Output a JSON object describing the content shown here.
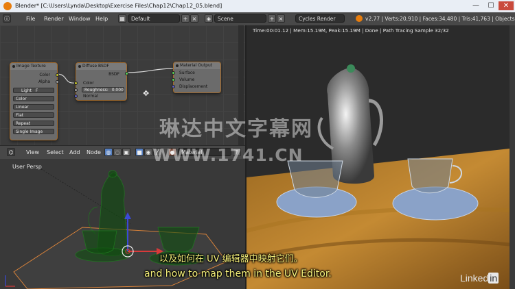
{
  "window": {
    "title": "Blender* [C:\\Users\\Lynda\\Desktop\\Exercise Files\\Chap12\\Chap12_05.blend]",
    "minimize_glyph": "—",
    "maximize_glyph": "☐",
    "close_glyph": "✕"
  },
  "info_header": {
    "menus": [
      "File",
      "Render",
      "Window",
      "Help"
    ],
    "screen_layout": "Default",
    "scene": "Scene",
    "render_engine": "Cycles Render",
    "stats": "v2.77 | Verts:20,910 | Faces:34,480 | Tris:41,763 | Objects:1/14"
  },
  "nodes": {
    "image_texture": {
      "title": "Image Texture",
      "out_color": "Color",
      "out_alpha": "Alpha",
      "image_name": "Light",
      "image_user": "F",
      "color_space": "Color",
      "interpolation": "Linear",
      "projection": "Flat",
      "extension": "Repeat",
      "single_image": "Single Image"
    },
    "diffuse": {
      "title": "Diffuse BSDF",
      "out_bsdf": "BSDF",
      "in_color": "Color",
      "roughness": "Roughness:",
      "roughness_value": "0.000",
      "in_normal": "Normal"
    },
    "output": {
      "title": "Material Output",
      "surface": "Surface",
      "volume": "Volume",
      "displacement": "Displacement"
    },
    "colors": {
      "color_socket": "#c7c729",
      "shader_socket": "#5bd15b",
      "vector_socket": "#6363c7",
      "gray_socket": "#a1a1a1"
    }
  },
  "node_header": {
    "menus": [
      "View",
      "Select",
      "Add",
      "Node"
    ],
    "material_label": "Material",
    "f_button": "F"
  },
  "viewport": {
    "label": "User Persp"
  },
  "render": {
    "status": "Time:00:01.12 | Mem:15.19M, Peak:15.19M | Done | Path Tracing Sample 32/32"
  },
  "overlay": {
    "watermark_line1": "琳达中文字幕网",
    "watermark_line2": "WWW.1741.CN",
    "subtitle_cn": "以及如何在 UV 编辑器中映射它们。",
    "subtitle_en": "and how to map them in the UV Editor.",
    "brand_left": "Linked",
    "brand_right": "in"
  }
}
